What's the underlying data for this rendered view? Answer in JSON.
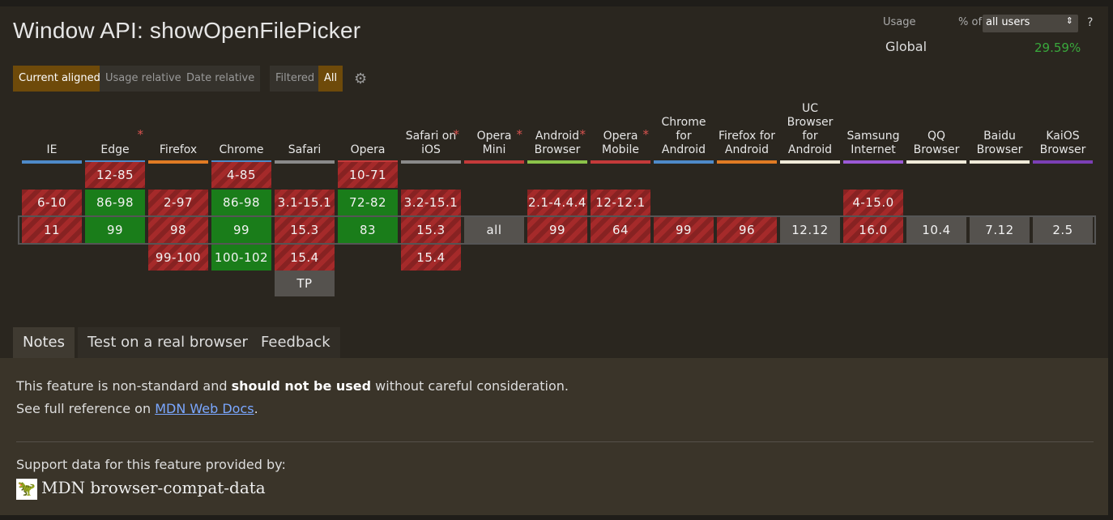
{
  "title": "Window API: showOpenFilePicker",
  "usage": {
    "usage_label": "Usage",
    "pct_of_label": "% of",
    "users_select": "all users",
    "help": "?",
    "global_label": "Global",
    "global_value": "29.59%",
    "global_value_color": "#39a83c"
  },
  "modes": {
    "current_aligned": "Current aligned",
    "usage_relative": "Usage relative",
    "date_relative": "Date relative",
    "filtered": "Filtered",
    "all": "All"
  },
  "browsers": [
    {
      "name": "IE",
      "color": "#4e8ac9",
      "star": false
    },
    {
      "name": "Edge",
      "color": "#4e8ac9",
      "star": true
    },
    {
      "name": "Firefox",
      "color": "#e07b24",
      "star": false
    },
    {
      "name": "Chrome",
      "color": "#4e8ac9",
      "star": false
    },
    {
      "name": "Safari",
      "color": "#8a8a8a",
      "star": false
    },
    {
      "name": "Opera",
      "color": "#c43a3a",
      "star": false
    },
    {
      "name": "Safari on iOS",
      "color": "#8a8a8a",
      "star": true
    },
    {
      "name": "Opera Mini",
      "color": "#c43a3a",
      "star": true
    },
    {
      "name": "Android Browser",
      "color": "#8bc34a",
      "star": true
    },
    {
      "name": "Opera Mobile",
      "color": "#c43a3a",
      "star": true
    },
    {
      "name": "Chrome for Android",
      "color": "#4e8ac9",
      "star": false
    },
    {
      "name": "Firefox for Android",
      "color": "#e07b24",
      "star": false
    },
    {
      "name": "UC Browser for Android",
      "color": "#f0ead8",
      "star": false
    },
    {
      "name": "Samsung Internet",
      "color": "#9b59d6",
      "star": false
    },
    {
      "name": "QQ Browser",
      "color": "#f0ead8",
      "star": false
    },
    {
      "name": "Baidu Browser",
      "color": "#f0ead8",
      "star": false
    },
    {
      "name": "KaiOS Browser",
      "color": "#7b3fb5",
      "star": false
    }
  ],
  "support": [
    {
      "col": 1,
      "row": 0,
      "label": "12-85",
      "status": "n"
    },
    {
      "col": 3,
      "row": 0,
      "label": "4-85",
      "status": "n"
    },
    {
      "col": 5,
      "row": 0,
      "label": "10-71",
      "status": "n"
    },
    {
      "col": 0,
      "row": 1,
      "label": "6-10",
      "status": "n"
    },
    {
      "col": 1,
      "row": 1,
      "label": "86-98",
      "status": "y"
    },
    {
      "col": 2,
      "row": 1,
      "label": "2-97",
      "status": "n"
    },
    {
      "col": 3,
      "row": 1,
      "label": "86-98",
      "status": "y"
    },
    {
      "col": 4,
      "row": 1,
      "label": "3.1-15.1",
      "status": "n"
    },
    {
      "col": 5,
      "row": 1,
      "label": "72-82",
      "status": "y"
    },
    {
      "col": 6,
      "row": 1,
      "label": "3.2-15.1",
      "status": "n"
    },
    {
      "col": 8,
      "row": 1,
      "label": "2.1-4.4.4",
      "status": "n"
    },
    {
      "col": 9,
      "row": 1,
      "label": "12-12.1",
      "status": "n"
    },
    {
      "col": 13,
      "row": 1,
      "label": "4-15.0",
      "status": "n"
    },
    {
      "col": 0,
      "row": 2,
      "label": "11",
      "status": "n"
    },
    {
      "col": 1,
      "row": 2,
      "label": "99",
      "status": "y"
    },
    {
      "col": 2,
      "row": 2,
      "label": "98",
      "status": "n"
    },
    {
      "col": 3,
      "row": 2,
      "label": "99",
      "status": "y"
    },
    {
      "col": 4,
      "row": 2,
      "label": "15.3",
      "status": "n"
    },
    {
      "col": 5,
      "row": 2,
      "label": "83",
      "status": "y"
    },
    {
      "col": 6,
      "row": 2,
      "label": "15.3",
      "status": "n"
    },
    {
      "col": 7,
      "row": 2,
      "label": "all",
      "status": "u"
    },
    {
      "col": 8,
      "row": 2,
      "label": "99",
      "status": "n"
    },
    {
      "col": 9,
      "row": 2,
      "label": "64",
      "status": "n"
    },
    {
      "col": 10,
      "row": 2,
      "label": "99",
      "status": "n"
    },
    {
      "col": 11,
      "row": 2,
      "label": "96",
      "status": "n"
    },
    {
      "col": 12,
      "row": 2,
      "label": "12.12",
      "status": "u"
    },
    {
      "col": 13,
      "row": 2,
      "label": "16.0",
      "status": "n"
    },
    {
      "col": 14,
      "row": 2,
      "label": "10.4",
      "status": "u"
    },
    {
      "col": 15,
      "row": 2,
      "label": "7.12",
      "status": "u"
    },
    {
      "col": 16,
      "row": 2,
      "label": "2.5",
      "status": "u"
    },
    {
      "col": 2,
      "row": 3,
      "label": "99-100",
      "status": "n"
    },
    {
      "col": 3,
      "row": 3,
      "label": "100-102",
      "status": "y"
    },
    {
      "col": 4,
      "row": 3,
      "label": "15.4",
      "status": "n"
    },
    {
      "col": 6,
      "row": 3,
      "label": "15.4",
      "status": "n"
    },
    {
      "col": 4,
      "row": 4,
      "label": "TP",
      "status": "u"
    }
  ],
  "tabs": {
    "notes": "Notes",
    "test": "Test on a real browser",
    "feedback": "Feedback"
  },
  "notes": {
    "line1_pre": "This feature is non-standard and ",
    "line1_bold": "should not be used",
    "line1_post": " without careful consideration.",
    "line2_pre": "See full reference on ",
    "line2_link": "MDN Web Docs",
    "line2_post": ".",
    "support_by": "Support data for this feature provided by:",
    "mdn_text": "MDN browser-compat-data"
  }
}
